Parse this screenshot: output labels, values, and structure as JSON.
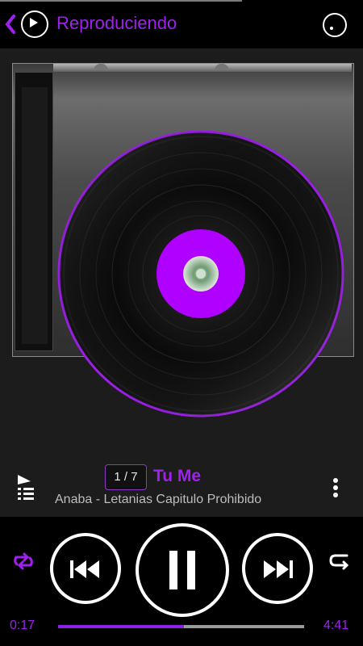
{
  "header": {
    "title": "Reproduciendo",
    "icons": [
      "back-chevron-icon",
      "play-circle-icon",
      "menu-circle-icon"
    ]
  },
  "player": {
    "track_position": "1 / 7",
    "title": "Tu Me",
    "artist_album": "Anaba        - Letanias Capitulo Prohibido",
    "current_time": "0:17",
    "total_time": "4:41",
    "progress": 0.51
  },
  "colors": {
    "accent": "#a020f0",
    "background": "#1c1c1c",
    "label": "#b000ff"
  },
  "controls": [
    "repeat-icon",
    "previous-button",
    "pause-button",
    "next-button",
    "shuffle-icon",
    "queue-icon",
    "more-options-icon"
  ]
}
